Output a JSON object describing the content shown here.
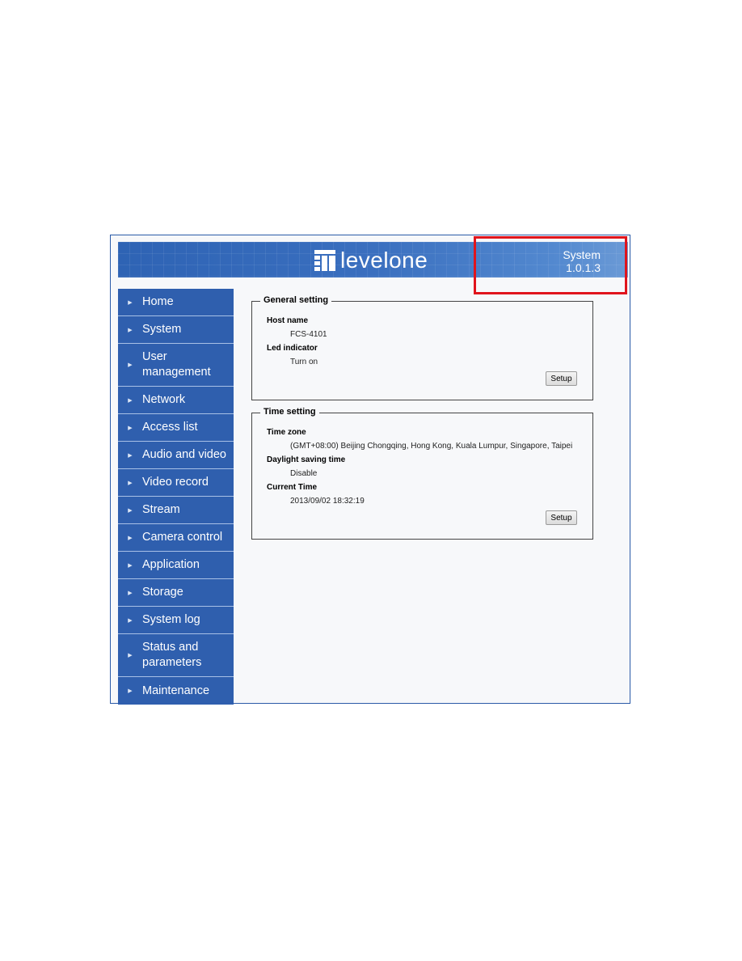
{
  "header": {
    "brand": "levelone",
    "page_name": "System",
    "version": "1.0.1.3"
  },
  "sidebar": {
    "items": [
      {
        "label": "Home"
      },
      {
        "label": "System"
      },
      {
        "label": "User management"
      },
      {
        "label": "Network"
      },
      {
        "label": "Access list"
      },
      {
        "label": "Audio and video"
      },
      {
        "label": "Video record"
      },
      {
        "label": "Stream"
      },
      {
        "label": "Camera control"
      },
      {
        "label": "Application"
      },
      {
        "label": "Storage"
      },
      {
        "label": "System log"
      },
      {
        "label": "Status and parameters"
      },
      {
        "label": "Maintenance"
      }
    ]
  },
  "general_setting": {
    "title": "General setting",
    "host_name_label": "Host name",
    "host_name_value": "FCS-4101",
    "led_label": "Led indicator",
    "led_value": "Turn on",
    "setup_label": "Setup"
  },
  "time_setting": {
    "title": "Time setting",
    "time_zone_label": "Time zone",
    "time_zone_value": "(GMT+08:00) Beijing Chongqing, Hong Kong, Kuala Lumpur, Singapore, Taipei",
    "dst_label": "Daylight saving time",
    "dst_value": "Disable",
    "current_time_label": "Current Time",
    "current_time_value": "2013/09/02 18:32:19",
    "setup_label": "Setup"
  },
  "colors": {
    "nav_bg": "#2f5fae",
    "banner_bg": "#3a6fbf",
    "highlight": "#e0141c"
  }
}
